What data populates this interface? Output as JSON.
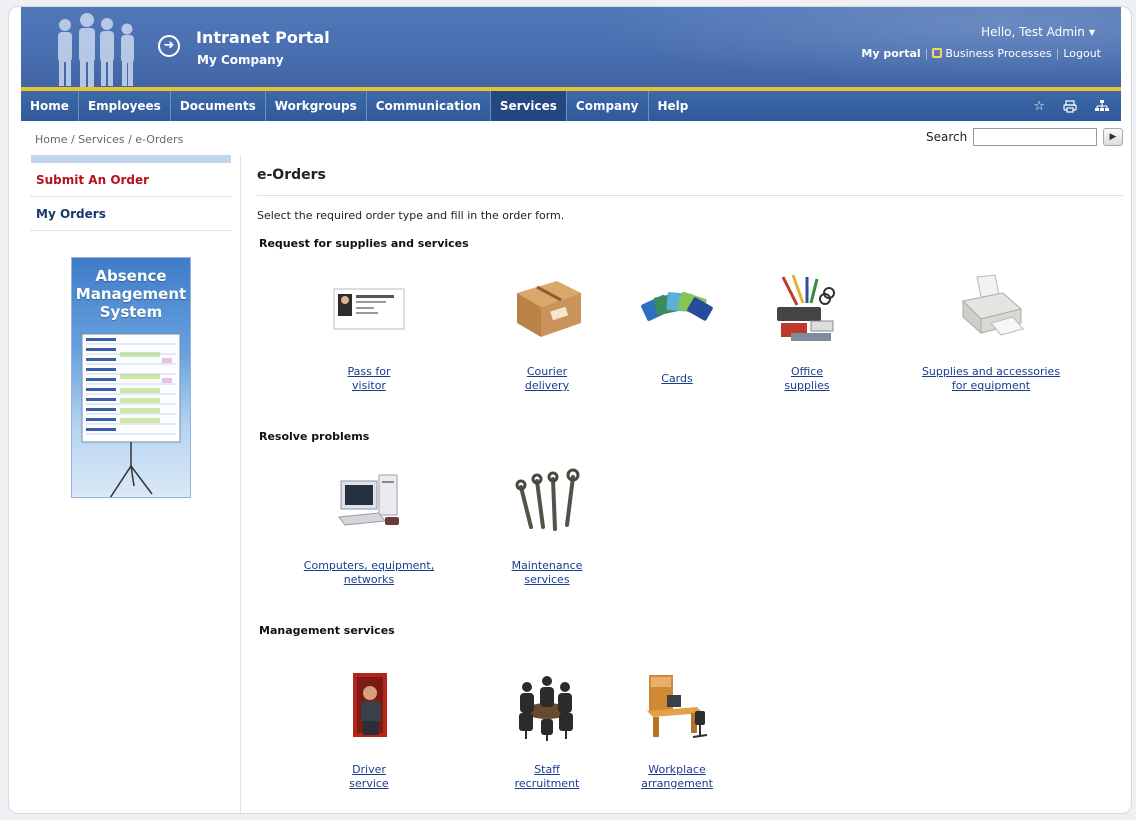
{
  "header": {
    "title": "Intranet Portal",
    "company": "My Company",
    "greeting": "Hello, Test Admin",
    "links": {
      "my_portal": "My portal",
      "business_processes": "Business Processes",
      "logout": "Logout"
    }
  },
  "nav": {
    "items": [
      "Home",
      "Employees",
      "Documents",
      "Workgroups",
      "Communication",
      "Services",
      "Company",
      "Help"
    ],
    "active": "Services",
    "tools": [
      "star-icon",
      "print-icon",
      "sitemap-icon"
    ]
  },
  "breadcrumb": "Home / Services / e-Orders",
  "search": {
    "label": "Search",
    "value": ""
  },
  "sidebar": {
    "items": [
      {
        "label": "Submit An Order",
        "color": "#b5121b"
      },
      {
        "label": "My Orders",
        "color": "#17386b"
      }
    ],
    "banner": {
      "line1": "Absence",
      "line2": "Management",
      "line3": "System"
    }
  },
  "main": {
    "title": "e-Orders",
    "intro": "Select the required order type and fill in the order form.",
    "sections": [
      {
        "title": "Request for supplies and services",
        "tiles": [
          {
            "icon": "visitor-pass-icon",
            "line1": "Pass for",
            "line2": "visitor"
          },
          {
            "icon": "courier-package-icon",
            "line1": "Courier",
            "line2": "delivery"
          },
          {
            "icon": "cards-icon",
            "line1": "Cards",
            "line2": ""
          },
          {
            "icon": "office-supplies-icon",
            "line1": "Office",
            "line2": "supplies"
          },
          {
            "icon": "printer-icon",
            "line1": "Supplies and accessories",
            "line2": "for equipment"
          }
        ]
      },
      {
        "title": "Resolve problems",
        "tiles": [
          {
            "icon": "computer-icon",
            "line1": "Computers, equipment,",
            "line2": "networks"
          },
          {
            "icon": "wrenches-icon",
            "line1": "Maintenance",
            "line2": "services"
          }
        ]
      },
      {
        "title": "Management services",
        "tiles": [
          {
            "icon": "driver-icon",
            "line1": "Driver",
            "line2": "service"
          },
          {
            "icon": "meeting-icon",
            "line1": "Staff",
            "line2": "recruitment"
          },
          {
            "icon": "workplace-desk-icon",
            "line1": "Workplace",
            "line2": "arrangement"
          }
        ]
      }
    ]
  },
  "colors": {
    "header": "#4a6fb0",
    "nav": "#30599a",
    "accent_gold": "#e8c431",
    "link": "#1a3d8f"
  }
}
